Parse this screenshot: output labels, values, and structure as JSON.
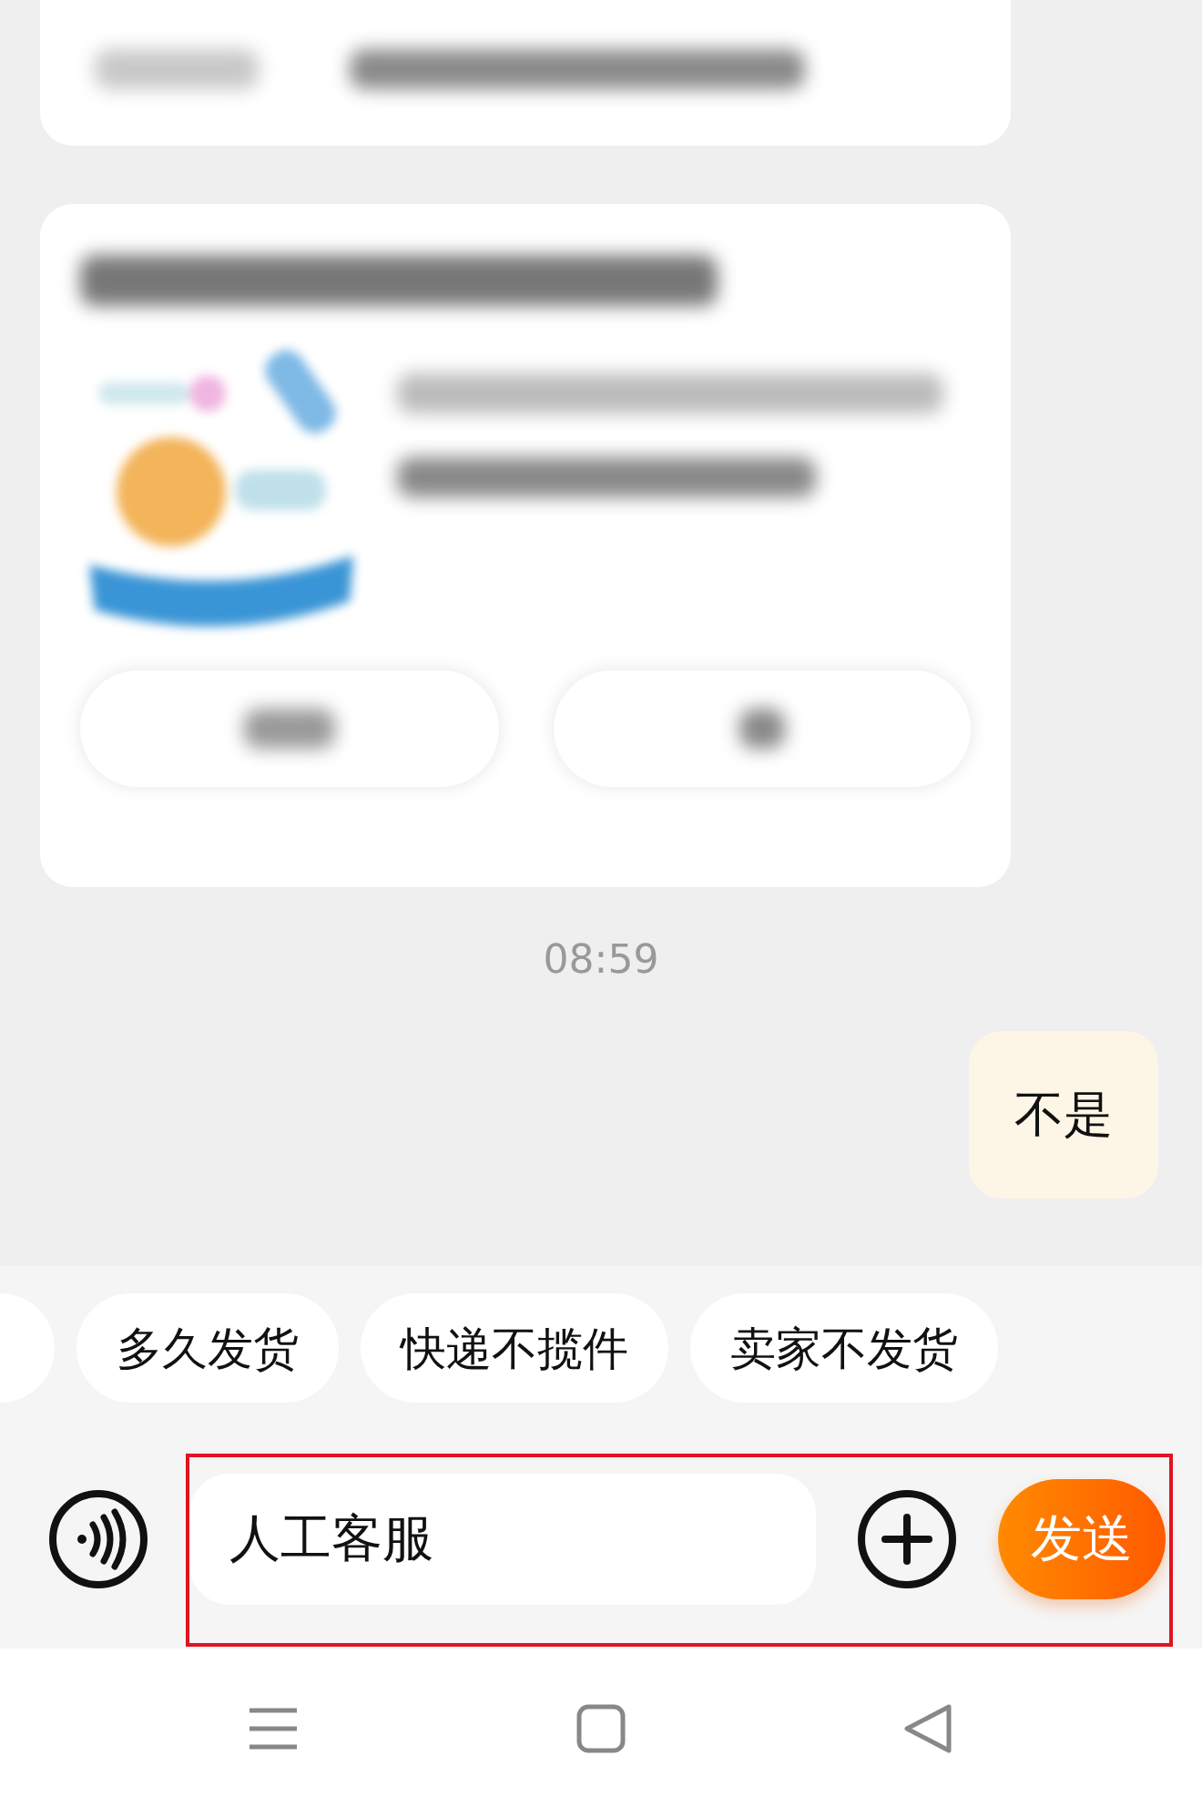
{
  "chat": {
    "timestamp": "08:59",
    "messages": [
      {
        "kind": "outgoing",
        "text": "不是"
      }
    ]
  },
  "quick_replies": [
    "多久发货",
    "快递不揽件",
    "卖家不发货"
  ],
  "composer": {
    "value": "人工客服",
    "send_label": "发送",
    "highlighted": true
  }
}
